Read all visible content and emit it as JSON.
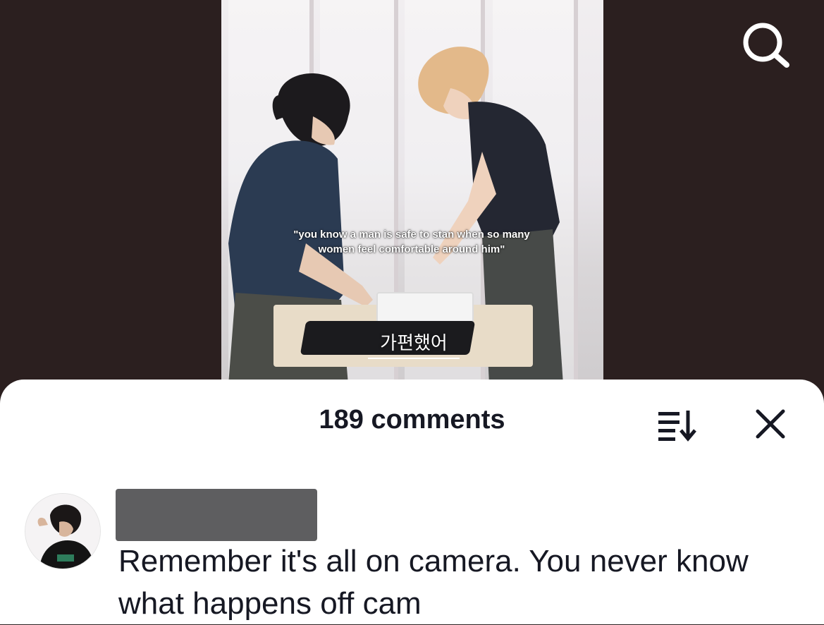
{
  "video": {
    "overlay_caption_line1": "\"you know a man is safe to stan when so many",
    "overlay_caption_line2": "women feel comfortable around him\"",
    "korean_subtitle": "가편했어"
  },
  "header": {
    "search_icon": "search-icon"
  },
  "comments_sheet": {
    "title": "189 comments",
    "sort_icon": "sort-icon",
    "close_icon": "close-icon",
    "comments": [
      {
        "avatar": "user-avatar",
        "username_redacted": true,
        "text": "Remember it's all on camera. You never know what happens off cam"
      }
    ]
  },
  "colors": {
    "background": "#2b1f1f",
    "sheet": "#ffffff",
    "text": "#161823"
  }
}
